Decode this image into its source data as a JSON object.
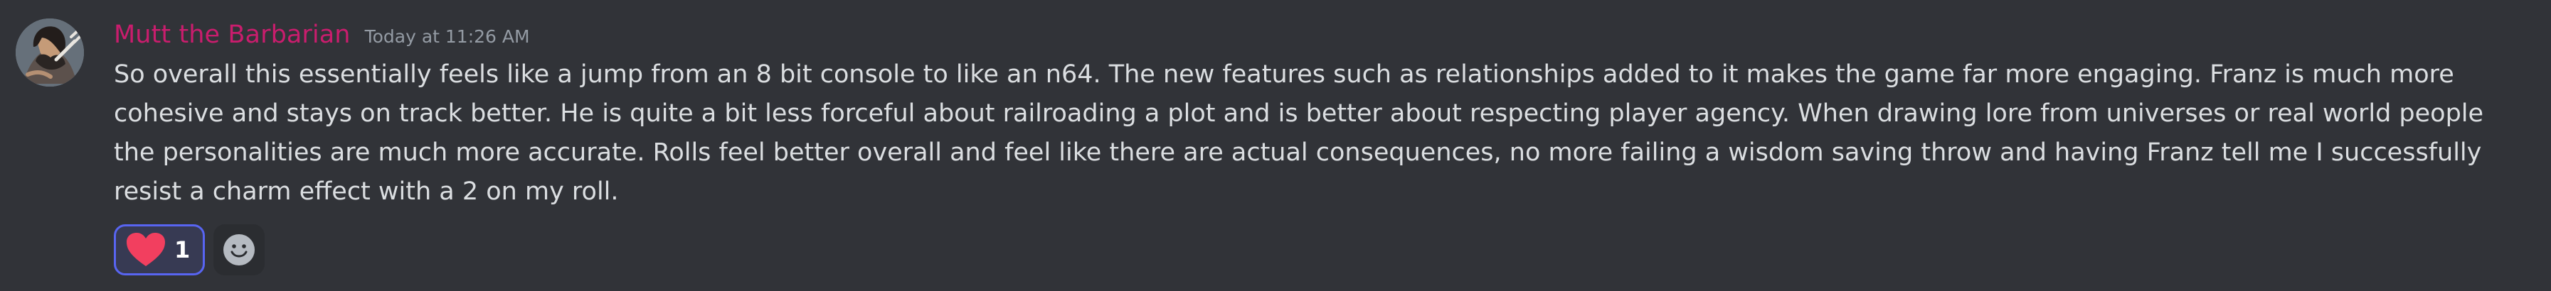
{
  "message": {
    "author": "Mutt the Barbarian",
    "timestamp": "Today at 11:26 AM",
    "author_color": "#c91d6d",
    "text": "So overall this essentially feels like a jump from an 8 bit console to like an n64. The new features such as relationships added to it makes the game far more engaging. Franz is much more cohesive and stays on track better. He is quite a bit less forceful about railroading a plot and is better about respecting player agency. When drawing lore from universes or real world people the personalities are much more accurate. Rolls feel better overall and feel like there are actual consequences, no more failing a wisdom saving throw and having Franz tell me I successfully resist a charm effect with a 2 on my roll."
  },
  "reactions": [
    {
      "emoji": "heart-icon",
      "count": "1",
      "selected": true
    }
  ],
  "add_reaction": {
    "icon": "smile-icon"
  },
  "colors": {
    "background": "#313338",
    "text": "#dbdee1",
    "muted": "#949ba4",
    "reaction_accent": "#5865f2",
    "heart": "#f23f5f"
  }
}
